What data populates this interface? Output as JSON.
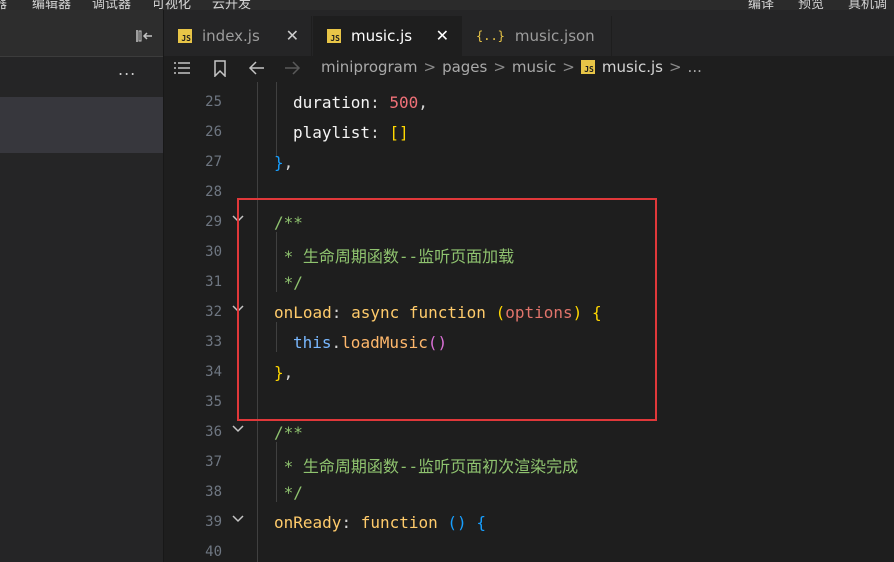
{
  "menubar": {
    "left_items": [
      "器",
      "编辑器",
      "调试器",
      "可视化",
      "云开发"
    ],
    "right_items": [
      "编译",
      "预览",
      "真机调"
    ]
  },
  "leftpanel": {
    "more_label": "..."
  },
  "tabs": [
    {
      "label": "index.js",
      "icon": "js-file-icon",
      "active": false,
      "close": "✕"
    },
    {
      "label": "music.js",
      "icon": "js-file-icon",
      "active": true,
      "close": "✕"
    },
    {
      "label": "music.json",
      "icon": "json-file-icon",
      "active": false
    }
  ],
  "badges": {
    "js": "JS",
    "json": "{..}"
  },
  "breadcrumb": {
    "items": [
      "miniprogram",
      "pages",
      "music",
      "music.js",
      "..."
    ],
    "separator": ">"
  },
  "editor": {
    "lines": [
      {
        "no": "25",
        "tokens": [
          {
            "t": "duration",
            "c": "tk-prop"
          },
          {
            "t": ": ",
            "c": ""
          },
          {
            "t": "500",
            "c": "tk-num"
          },
          {
            "t": ",",
            "c": ""
          }
        ]
      },
      {
        "no": "26",
        "tokens": [
          {
            "t": "playlist",
            "c": "tk-prop"
          },
          {
            "t": ": ",
            "c": ""
          },
          {
            "t": "[]",
            "c": "tk-br"
          }
        ]
      },
      {
        "no": "27",
        "tokens": [
          {
            "t": "}",
            "c": "tk-br3"
          },
          {
            "t": ",",
            "c": ""
          }
        ]
      },
      {
        "no": "28",
        "tokens": []
      },
      {
        "no": "29",
        "tokens": [
          {
            "t": "/**",
            "c": "tk-com"
          }
        ]
      },
      {
        "no": "30",
        "tokens": [
          {
            "t": " * 生命周期函数--监听页面加载",
            "c": "tk-com"
          }
        ]
      },
      {
        "no": "31",
        "tokens": [
          {
            "t": " */",
            "c": "tk-com"
          }
        ]
      },
      {
        "no": "32",
        "tokens": [
          {
            "t": "onLoad",
            "c": "tk-fn"
          },
          {
            "t": ": ",
            "c": ""
          },
          {
            "t": "async",
            "c": "tk-kw"
          },
          {
            "t": " ",
            "c": ""
          },
          {
            "t": "function",
            "c": "tk-kw"
          },
          {
            "t": " ",
            "c": ""
          },
          {
            "t": "(",
            "c": "tk-br"
          },
          {
            "t": "options",
            "c": "tk-param"
          },
          {
            "t": ")",
            "c": "tk-br"
          },
          {
            "t": " ",
            "c": ""
          },
          {
            "t": "{",
            "c": "tk-br"
          }
        ]
      },
      {
        "no": "33",
        "tokens": [
          {
            "t": "this",
            "c": "tk-this"
          },
          {
            "t": ".",
            "c": ""
          },
          {
            "t": "loadMusic",
            "c": "tk-call"
          },
          {
            "t": "()",
            "c": "tk-br2"
          }
        ]
      },
      {
        "no": "34",
        "tokens": [
          {
            "t": "}",
            "c": "tk-br"
          },
          {
            "t": ",",
            "c": ""
          }
        ]
      },
      {
        "no": "35",
        "tokens": []
      },
      {
        "no": "36",
        "tokens": [
          {
            "t": "/**",
            "c": "tk-com"
          }
        ]
      },
      {
        "no": "37",
        "tokens": [
          {
            "t": " * 生命周期函数--监听页面初次渲染完成",
            "c": "tk-com"
          }
        ]
      },
      {
        "no": "38",
        "tokens": [
          {
            "t": " */",
            "c": "tk-com"
          }
        ]
      },
      {
        "no": "39",
        "tokens": [
          {
            "t": "onReady",
            "c": "tk-fn"
          },
          {
            "t": ": ",
            "c": ""
          },
          {
            "t": "function",
            "c": "tk-kw"
          },
          {
            "t": " ",
            "c": ""
          },
          {
            "t": "()",
            "c": "tk-br3"
          },
          {
            "t": " ",
            "c": ""
          },
          {
            "t": "{",
            "c": "tk-br3"
          }
        ]
      },
      {
        "no": "40",
        "tokens": []
      }
    ]
  },
  "colors": {
    "highlight_box": "#e0383a",
    "comment": "#8fc36f",
    "number": "#f07178",
    "keyword": "#ffcb6b"
  }
}
